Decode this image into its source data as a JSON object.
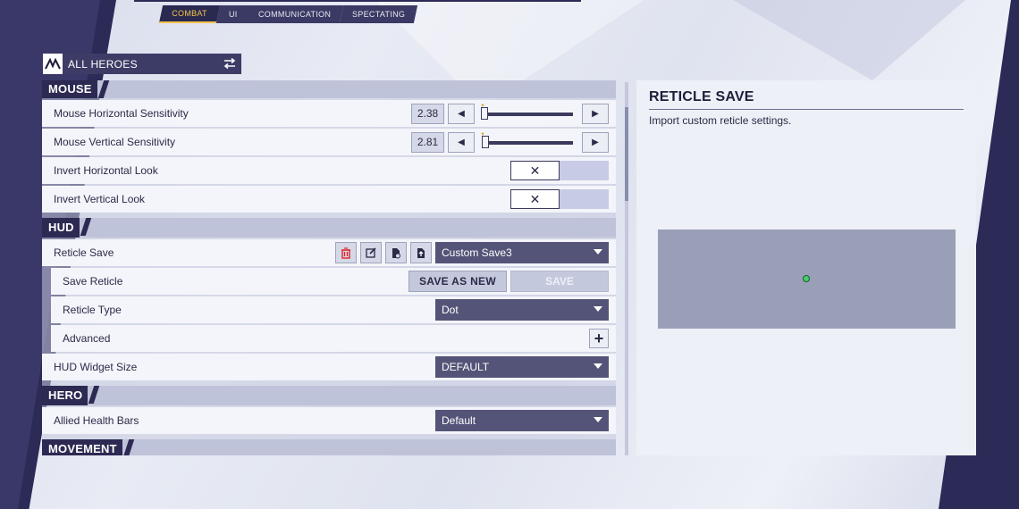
{
  "tabs": [
    {
      "label": "COMBAT",
      "active": true
    },
    {
      "label": "UI",
      "active": false
    },
    {
      "label": "COMMUNICATION",
      "active": false
    },
    {
      "label": "SPECTATING",
      "active": false
    }
  ],
  "hero_selector": {
    "label": "ALL HEROES",
    "icon": "swap-arrows-icon"
  },
  "sections": {
    "mouse": "MOUSE",
    "hud": "HUD",
    "hero": "HERO",
    "movement": "MOVEMENT"
  },
  "mouse": {
    "horizontal_sensitivity": {
      "label": "Mouse Horizontal Sensitivity",
      "value": "2.38"
    },
    "vertical_sensitivity": {
      "label": "Mouse Vertical Sensitivity",
      "value": "2.81"
    },
    "invert_horizontal": {
      "label": "Invert Horizontal Look",
      "state": "off"
    },
    "invert_vertical": {
      "label": "Invert Vertical Look",
      "state": "off"
    }
  },
  "hud": {
    "reticle_save": {
      "label": "Reticle Save",
      "selected": "Custom Save3"
    },
    "save_reticle": {
      "label": "Save Reticle",
      "save_as_new": "SAVE AS NEW",
      "save": "SAVE"
    },
    "reticle_type": {
      "label": "Reticle Type",
      "selected": "Dot"
    },
    "advanced": {
      "label": "Advanced"
    },
    "hud_widget_size": {
      "label": "HUD Widget Size",
      "selected": "DEFAULT"
    }
  },
  "hero": {
    "allied_health_bars": {
      "label": "Allied Health Bars",
      "selected": "Default"
    }
  },
  "panel": {
    "title": "RETICLE SAVE",
    "description": "Import custom reticle settings."
  },
  "colors": {
    "accent": "#f2c24a",
    "dark": "#2c2a52",
    "dropdown": "#545478",
    "delete": "#e0242a",
    "reticle_dot": "#3fd16a"
  }
}
